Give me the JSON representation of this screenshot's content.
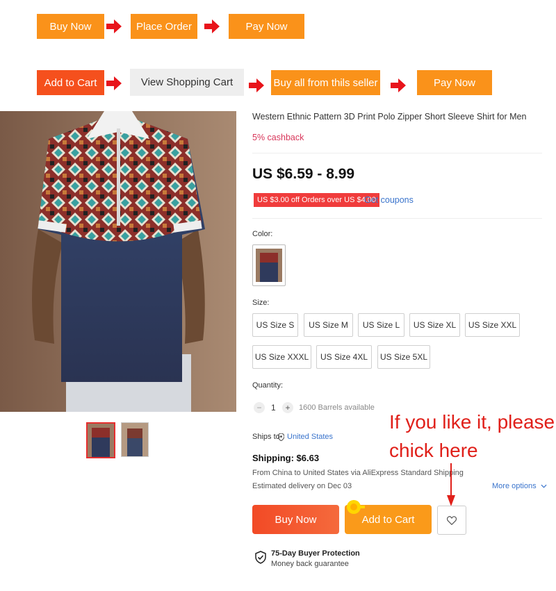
{
  "flow1": {
    "buy_now": "Buy Now",
    "place_order": "Place Order",
    "pay_now": "Pay Now"
  },
  "flow2": {
    "add_to_cart": "Add to Cart",
    "view_cart": "View Shopping Cart",
    "buy_all": "Buy all from thils seller",
    "pay_now": "Pay Now"
  },
  "product": {
    "title": "Western Ethnic Pattern 3D Print Polo Zipper Short Sleeve Shirt for Men",
    "cashback": "5% cashback",
    "price": "US $6.59 - 8.99",
    "coupon": "US $3.00 off Orders over US $4.00",
    "get_coupons": "Get coupons",
    "color_label": "Color:",
    "size_label": "Size:",
    "sizes": [
      "US Size S",
      "US Size M",
      "US Size L",
      "US Size XL",
      "US Size XXL",
      "US Size XXXL",
      "US Size 4XL",
      "US Size 5XL"
    ],
    "quantity_label": "Quantity:",
    "quantity": "1",
    "minus": "−",
    "plus": "+",
    "available": "1600 Barrels available",
    "ships_to_label": "Ships to",
    "ships_to_country": "United States",
    "shipping": "Shipping: $6.63",
    "shipping_detail": "From China to United States via AliExpress Standard Shipping",
    "delivery": "Estimated delivery on Dec 03",
    "more_options": "More options",
    "buy_now": "Buy Now",
    "add_to_cart": "Add to Cart",
    "protection_title": "75-Day Buyer Protection",
    "protection_sub": "Money back guarantee"
  },
  "annotation": {
    "line1": "If you like it, please",
    "line2": "chick here"
  },
  "icons": {
    "arrow": "red-right-arrow-icon",
    "heart": "heart-icon",
    "location": "location-pin-icon",
    "shield": "shield-check-icon",
    "chevron": "chevron-down-icon"
  },
  "colors": {
    "orange": "#fa921a",
    "red_orange": "#f5501d",
    "coupon_red": "#f03c3c",
    "link_blue": "#3a74cc",
    "annotation_red": "#e0201a"
  }
}
